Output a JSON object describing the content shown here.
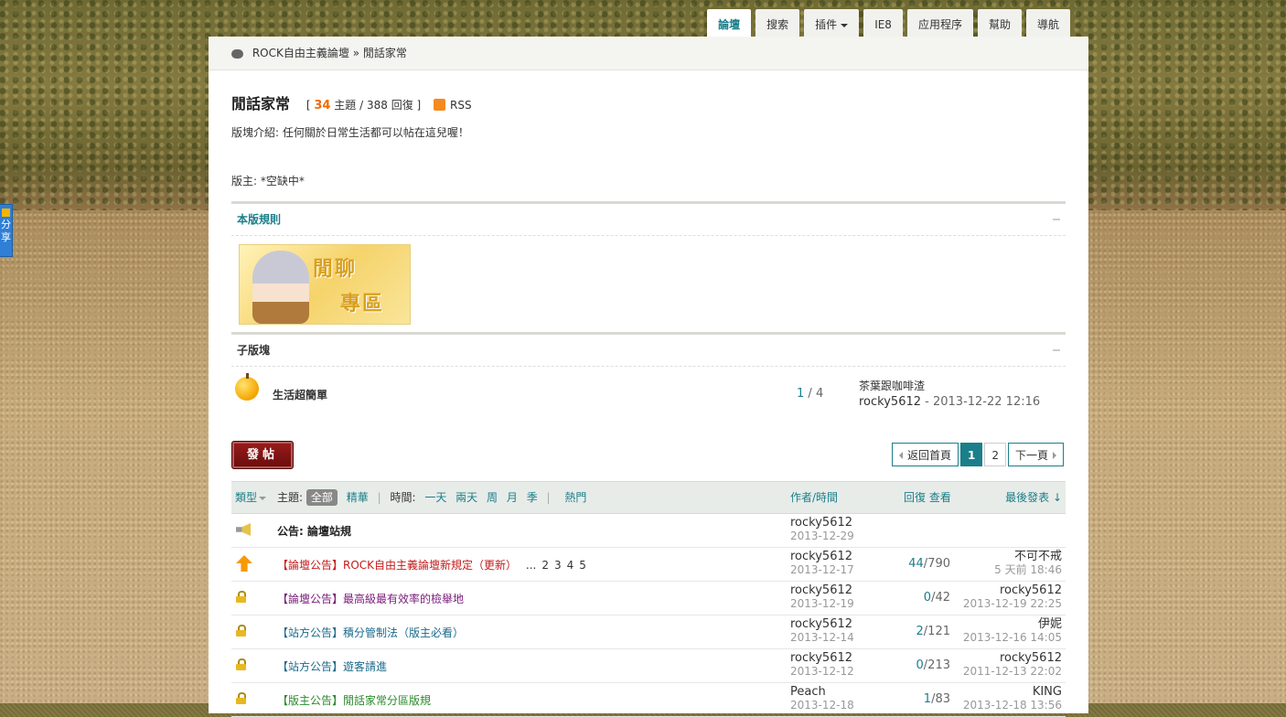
{
  "nav": {
    "tabs": [
      {
        "label": "論壇",
        "active": true
      },
      {
        "label": "搜索"
      },
      {
        "label": "插件"
      },
      {
        "label": "IE8"
      },
      {
        "label": "应用程序"
      },
      {
        "label": "幫助"
      },
      {
        "label": "導航"
      }
    ]
  },
  "share": {
    "label": "分享"
  },
  "breadcrumb": {
    "site": "ROCK自由主義論壇",
    "sep": "»",
    "current": "閒話家常"
  },
  "forum": {
    "title": "閒話家常",
    "threads": "34",
    "threads_label": "主題",
    "replies": "388",
    "replies_label": "回復",
    "rss": "RSS",
    "intro": "版塊介紹: 任何關於日常生活都可以帖在這兒喔！",
    "moderators": "版主: *空缺中*"
  },
  "rules": {
    "heading": "本版規則",
    "banner_line1": "閒聊",
    "banner_line2": "專區"
  },
  "subforums": {
    "heading": "子版塊",
    "items": [
      {
        "name": "生活超簡單",
        "threads": "1",
        "posts": "4",
        "last_title": "茶葉跟咖啡渣",
        "last_user": "rocky5612",
        "last_time": "2013-12-22 12:16"
      }
    ]
  },
  "actions": {
    "post_label": "發帖"
  },
  "pager": {
    "back": "返回首頁",
    "pages": [
      "1",
      "2"
    ],
    "current": "1",
    "next": "下一頁"
  },
  "table": {
    "header": {
      "type": "類型",
      "subject_label": "主題:",
      "all": "全部",
      "digest": "精華",
      "time_label": "時間:",
      "times": [
        "一天",
        "兩天",
        "周",
        "月",
        "季"
      ],
      "hot": "熱門",
      "author": "作者/時間",
      "replies_views": "回復 查看",
      "last_post": "最後發表 ↓"
    },
    "rows": [
      {
        "icon": "announcement-icon",
        "prefix": "",
        "title": "公告: 論壇站規",
        "style": "bold",
        "author": "rocky5612",
        "date": "2013-12-29",
        "replies": "",
        "views": "",
        "last_user": "",
        "last_time": ""
      },
      {
        "icon": "pinned-up-icon",
        "prefix": "【論壇公告】",
        "title": "ROCK自由主義論壇新規定（更新）",
        "style": "red",
        "pages": [
          "...",
          "2",
          "3",
          "4",
          "5"
        ],
        "author": "rocky5612",
        "date": "2013-12-17",
        "replies": "44",
        "views": "790",
        "last_user": "不可不戒",
        "last_time": "5 天前 18:46"
      },
      {
        "icon": "lock-icon",
        "prefix": "【論壇公告】",
        "title": "最高級最有效率的檢舉地",
        "style": "purple",
        "author": "rocky5612",
        "date": "2013-12-19",
        "replies": "0",
        "views": "42",
        "last_user": "rocky5612",
        "last_time": "2013-12-19 22:25"
      },
      {
        "icon": "lock-icon",
        "prefix": "【站方公告】",
        "title": "積分管制法（版主必看）",
        "style": "teal",
        "author": "rocky5612",
        "date": "2013-12-14",
        "replies": "2",
        "views": "121",
        "last_user": "伊妮",
        "last_time": "2013-12-16 14:05"
      },
      {
        "icon": "lock-icon",
        "prefix": "【站方公告】",
        "title": "遊客請進",
        "style": "teal",
        "author": "rocky5612",
        "date": "2013-12-12",
        "replies": "0",
        "views": "213",
        "last_user": "rocky5612",
        "last_time": "2011-12-13 22:02"
      },
      {
        "icon": "lock-icon",
        "prefix": "【版主公告】",
        "title": "閒話家常分區版規",
        "style": "green",
        "author": "Peach",
        "date": "2013-12-18",
        "replies": "1",
        "views": "83",
        "last_user": "KING",
        "last_time": "2013-12-18 13:56"
      }
    ]
  }
}
